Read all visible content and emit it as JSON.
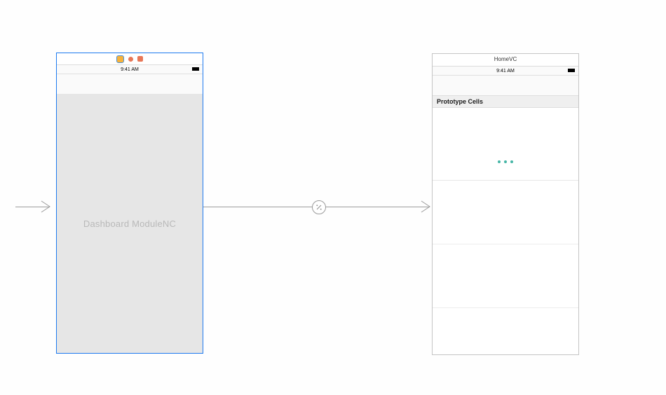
{
  "status_time": "9:41 AM",
  "scenes": {
    "left": {
      "placeholder_title": "Dashboard ModuleNC"
    },
    "right": {
      "title": "HomeVC",
      "prototype_header": "Prototype Cells"
    }
  }
}
